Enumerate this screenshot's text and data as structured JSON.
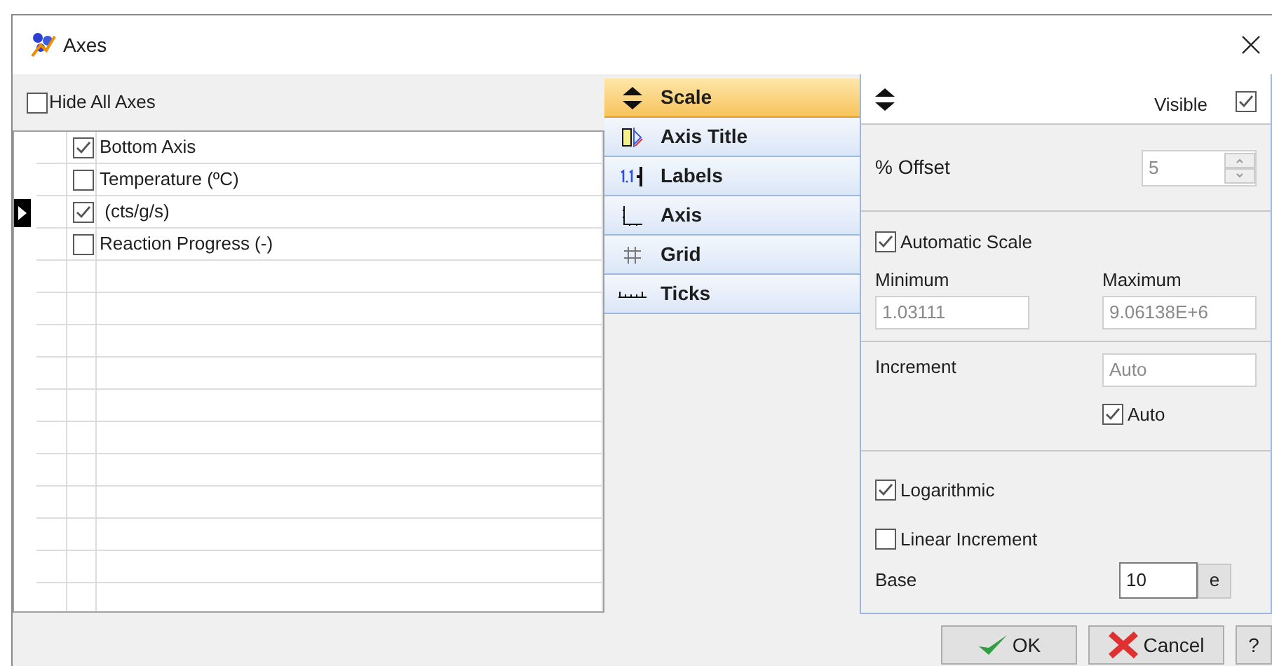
{
  "window": {
    "title": "Axes"
  },
  "hide_all_axes": {
    "label": "Hide All Axes",
    "checked": false
  },
  "axes": [
    {
      "label": "Bottom Axis",
      "checked": true,
      "selected": false
    },
    {
      "label": "Temperature (ºC)",
      "checked": false,
      "selected": false
    },
    {
      "label": " (cts/g/s)",
      "checked": true,
      "selected": true
    },
    {
      "label": "Reaction Progress (-)",
      "checked": false,
      "selected": false
    }
  ],
  "nav": [
    {
      "label": "Scale",
      "selected": true
    },
    {
      "label": "Axis Title",
      "selected": false
    },
    {
      "label": "Labels",
      "selected": false
    },
    {
      "label": "Axis",
      "selected": false
    },
    {
      "label": "Grid",
      "selected": false
    },
    {
      "label": "Ticks",
      "selected": false
    }
  ],
  "scale": {
    "visible": {
      "label": "Visible",
      "checked": true
    },
    "offset": {
      "label": "% Offset",
      "value": "5",
      "disabled": true
    },
    "automatic_scale": {
      "label": "Automatic Scale",
      "checked": true
    },
    "minimum": {
      "label": "Minimum",
      "value": "1.03111",
      "disabled": true
    },
    "maximum": {
      "label": "Maximum",
      "value": "9.06138E+6",
      "disabled": true
    },
    "increment": {
      "label": "Increment",
      "value": "Auto",
      "disabled": true
    },
    "increment_auto": {
      "label": "Auto",
      "checked": true
    },
    "logarithmic": {
      "label": "Logarithmic",
      "checked": true
    },
    "linear_increment": {
      "label": "Linear Increment",
      "checked": false
    },
    "base": {
      "label": "Base",
      "value": "10",
      "disabled": false,
      "button": "e"
    }
  },
  "buttons": [
    {
      "label": "OK",
      "kind": "ok"
    },
    {
      "label": "Cancel",
      "kind": "cancel"
    },
    {
      "label": "?",
      "kind": "help"
    }
  ]
}
